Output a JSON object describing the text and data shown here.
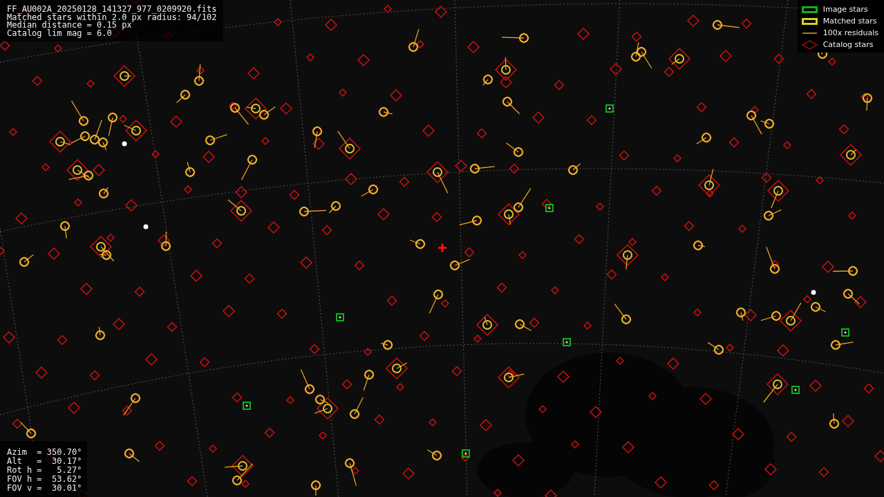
{
  "file_info": {
    "lines": [
      "FF_AU002A_20250128_141327_977_0209920.fits",
      "Matched stars within 2.0 px radius: 94/102",
      "Median distance = 0.15 px",
      "Catalog lim mag = 6.0"
    ]
  },
  "legend": [
    {
      "kind": "image",
      "label": "Image stars"
    },
    {
      "kind": "matched",
      "label": "Matched stars"
    },
    {
      "kind": "residual",
      "label": "100x residuals"
    },
    {
      "kind": "catalog",
      "label": "Catalog stars"
    }
  ],
  "pointing": {
    "lines": [
      "Azim  = 350.70°",
      "Alt   =  30.17°",
      "Rot h =   5.27°",
      "FOV h =  53.62°",
      "FOV v =  30.01°"
    ]
  }
}
